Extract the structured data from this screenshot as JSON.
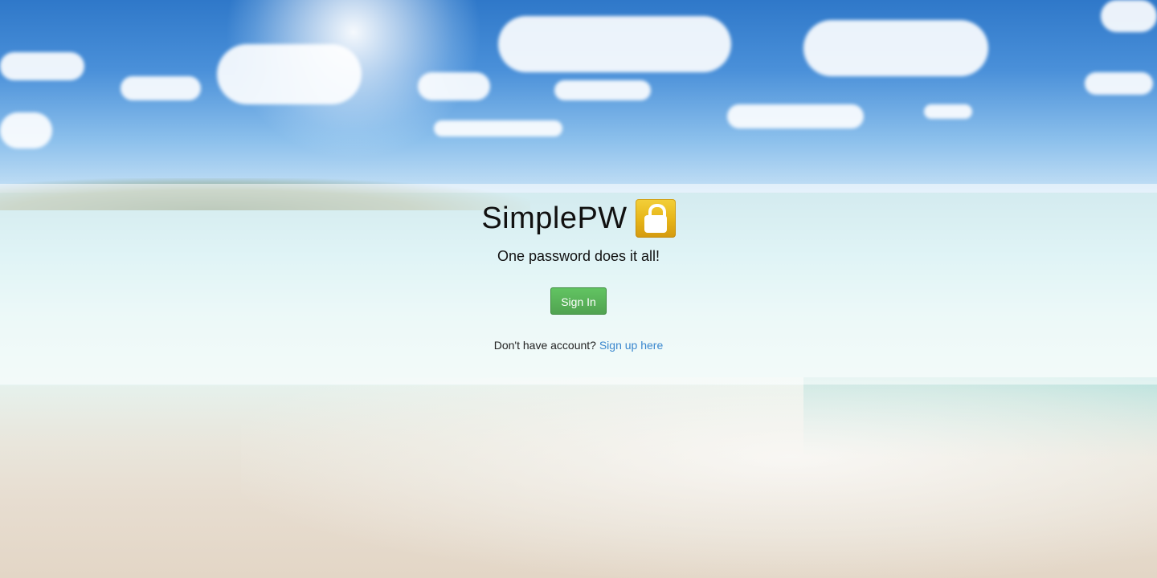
{
  "app": {
    "title": "SimplePW",
    "logo_icon": "lock-icon",
    "tagline": "One password does it all!"
  },
  "actions": {
    "sign_in_label": "Sign In",
    "signup_prompt": "Don't have account?",
    "signup_link_label": "Sign up here"
  },
  "colors": {
    "sign_in_button": "#5bb75b",
    "link": "#3a87ce",
    "lock_icon": "#e6b417"
  }
}
